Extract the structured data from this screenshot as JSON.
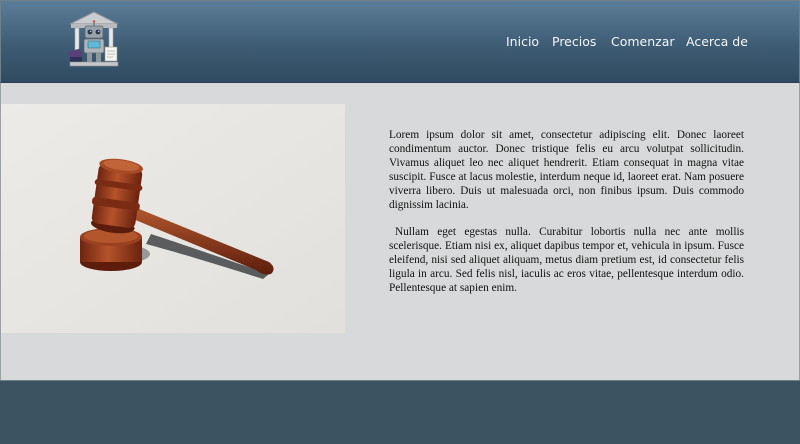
{
  "nav": {
    "items": [
      {
        "label": "Inicio"
      },
      {
        "label": "Precios"
      },
      {
        "label": "Comenzar"
      },
      {
        "label": "Acerca de"
      }
    ]
  },
  "logo": {
    "icon": "robot-courthouse-logo-icon"
  },
  "hero": {
    "image": "gavel-photo"
  },
  "content": {
    "paragraphs": [
      "Lorem ipsum dolor sit amet, consectetur adipiscing elit. Donec laoreet condimentum auctor. Donec tristique felis eu arcu volutpat sollicitudin. Vivamus aliquet leo nec aliquet hendrerit. Etiam consequat in magna vitae suscipit. Fusce at lacus molestie, interdum neque id, laoreet erat. Nam posuere viverra libero. Duis ut malesuada orci, non finibus ipsum. Duis commodo dignissim lacinia.",
      "Nullam eget egestas nulla. Curabitur lobortis nulla nec ante mollis scelerisque. Etiam nisi ex, aliquet dapibus tempor et, vehicula in ipsum. Fusce eleifend, nisi sed aliquet aliquam, metus diam pretium est, id consectetur felis ligula in arcu. Sed felis nisl, iaculis ac eros vitae, pellentesque interdum odio. Pellentesque at sapien enim."
    ]
  },
  "colors": {
    "header_top": "#5c7d98",
    "header_bottom": "#2f4b61",
    "body_bg": "#d8d9da",
    "footer_bg": "#3a5462",
    "nav_text": "#f3f6f8"
  }
}
